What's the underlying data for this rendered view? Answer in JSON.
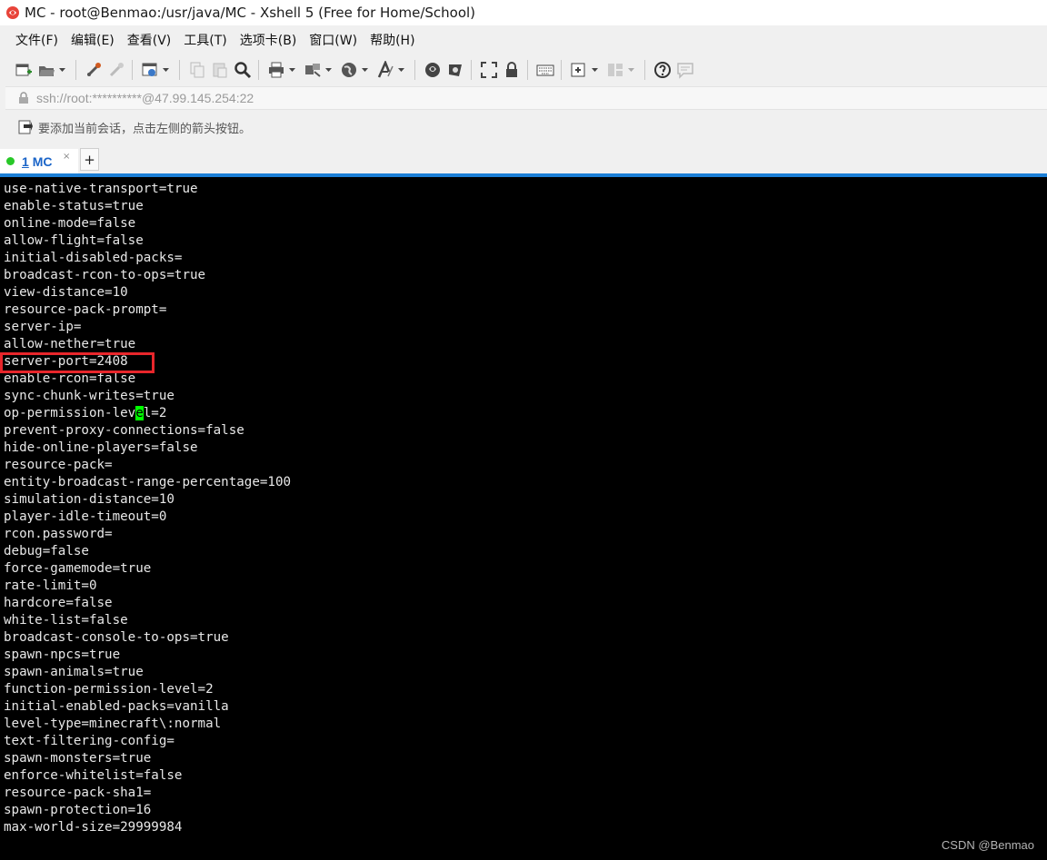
{
  "window": {
    "title": "MC - root@Benmao:/usr/java/MC - Xshell 5 (Free for Home/School)"
  },
  "menu": [
    "文件(F)",
    "编辑(E)",
    "查看(V)",
    "工具(T)",
    "选项卡(B)",
    "窗口(W)",
    "帮助(H)"
  ],
  "address": "ssh://root:**********@47.99.145.254:22",
  "hint": "要添加当前会话，点击左侧的箭头按钮。",
  "tab": {
    "number": "1",
    "label": "MC",
    "close_glyph": "×",
    "add_glyph": "+"
  },
  "terminal": {
    "lines": [
      "use-native-transport=true",
      "enable-status=true",
      "online-mode=false",
      "allow-flight=false",
      "initial-disabled-packs=",
      "broadcast-rcon-to-ops=true",
      "view-distance=10",
      "resource-pack-prompt=",
      "server-ip=",
      "allow-nether=true",
      "server-port=2408",
      "enable-rcon=false",
      "sync-chunk-writes=true",
      "op-permission-level=2",
      "prevent-proxy-connections=false",
      "hide-online-players=false",
      "resource-pack=",
      "entity-broadcast-range-percentage=100",
      "simulation-distance=10",
      "player-idle-timeout=0",
      "rcon.password=",
      "debug=false",
      "force-gamemode=true",
      "rate-limit=0",
      "hardcore=false",
      "white-list=false",
      "broadcast-console-to-ops=true",
      "spawn-npcs=true",
      "spawn-animals=true",
      "function-permission-level=2",
      "initial-enabled-packs=vanilla",
      "level-type=minecraft\\:normal",
      "text-filtering-config=",
      "spawn-monsters=true",
      "enforce-whitelist=false",
      "resource-pack-sha1=",
      "spawn-protection=16",
      "max-world-size=29999984"
    ],
    "highlighted_line": "server-port=2408",
    "cursor_line_parts": [
      "op-permission-lev",
      "e",
      "l=2"
    ]
  },
  "watermark": "CSDN @Benmao⁠",
  "colors": {
    "terminal_bg": "#000000",
    "terminal_fg": "#e8e8e8",
    "cursor": "#00ff00",
    "highlight_border": "#e8262b",
    "tab_accent": "#1c7fd6",
    "tab_text": "#1a64c8"
  },
  "toolbar_icons": [
    "new-session-icon",
    "open-folder-icon",
    "reconnect-icon",
    "disconnect-icon",
    "properties-icon",
    "copy-icon",
    "paste-icon",
    "find-icon",
    "print-icon",
    "transfer-icon",
    "globe-icon",
    "font-icon",
    "xftp-icon",
    "xmanager-icon",
    "fullscreen-icon",
    "lock-icon",
    "keyboard-icon",
    "add-tab-icon",
    "layout-icon",
    "help-icon",
    "chat-icon"
  ]
}
